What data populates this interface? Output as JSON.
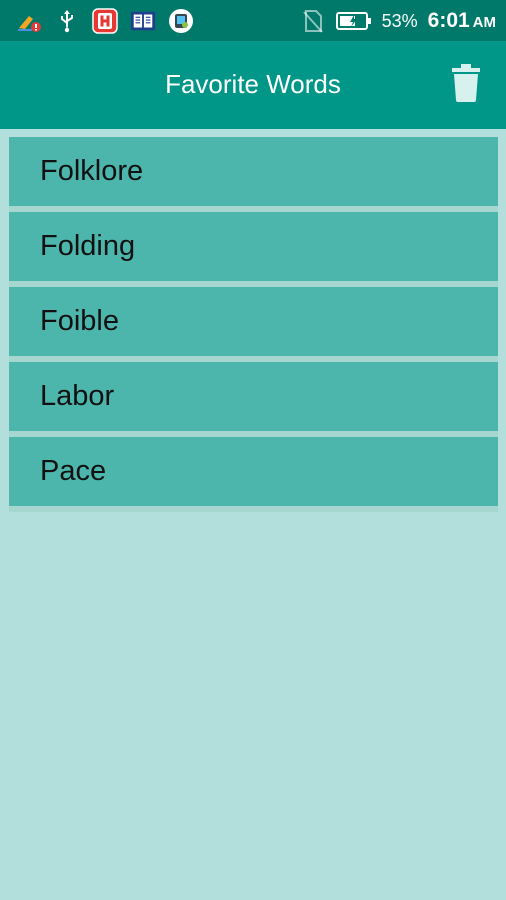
{
  "status_bar": {
    "icons_left": [
      "cleaner-icon",
      "usb-icon",
      "h-app-icon",
      "book-icon",
      "screen-icon"
    ],
    "icons_right": [
      "no-sim-icon",
      "battery-icon"
    ],
    "battery_percent": "53%",
    "time": "6:01",
    "ampm": "AM"
  },
  "app_bar": {
    "title": "Favorite Words",
    "action_icon": "trash-icon"
  },
  "words": [
    "Folklore",
    "Folding",
    "Foible",
    "Labor",
    "Pace"
  ],
  "colors": {
    "status_bar": "#00796b",
    "app_bar": "#009688",
    "list_item": "#4db6ac",
    "background": "#b2dfdb"
  }
}
